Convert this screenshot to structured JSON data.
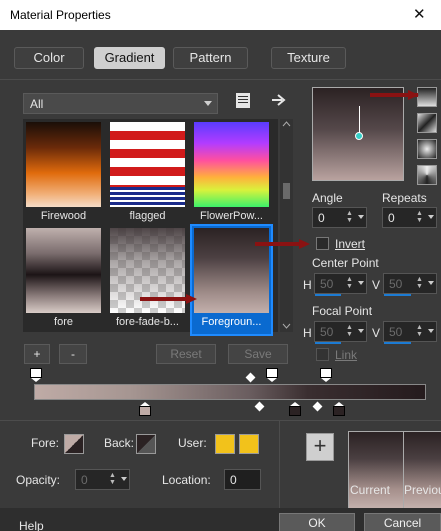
{
  "window": {
    "title": "Material Properties",
    "close": "✕"
  },
  "tabs": [
    {
      "label": "Color",
      "active": false
    },
    {
      "label": "Gradient",
      "active": true
    },
    {
      "label": "Pattern",
      "active": false
    },
    {
      "label": "Texture",
      "active": false
    }
  ],
  "category": {
    "value": "All"
  },
  "gallery": {
    "items": [
      {
        "label": "Firewood",
        "selected": false
      },
      {
        "label": "flagged",
        "selected": false
      },
      {
        "label": "FlowerPow...",
        "selected": false
      },
      {
        "label": "fore",
        "selected": false
      },
      {
        "label": "fore-fade-b...",
        "selected": false
      },
      {
        "label": "Foregroun...",
        "selected": true
      }
    ]
  },
  "controls": {
    "angle_label": "Angle",
    "angle_value": "0",
    "repeats_label": "Repeats",
    "repeats_value": "0",
    "invert_label": "Invert",
    "invert_checked": false,
    "center_label": "Center Point",
    "h_label": "H",
    "v_label": "V",
    "center_h": "50",
    "center_v": "50",
    "focal_label": "Focal Point",
    "focal_h": "50",
    "focal_v": "50",
    "link_label": "Link",
    "link_checked": false
  },
  "editor": {
    "add": "+",
    "remove": "-",
    "reset": "Reset",
    "save": "Save"
  },
  "footer": {
    "fore_label": "Fore:",
    "back_label": "Back:",
    "user_label": "User:",
    "user_color": "#f2c21b",
    "opacity_label": "Opacity:",
    "opacity_value": "0",
    "location_label": "Location:",
    "location_value": "0",
    "current_label": "Current",
    "previous_label": "Previous",
    "add_swatch": "+"
  },
  "buttons": {
    "help": "Help",
    "ok": "OK",
    "cancel": "Cancel"
  }
}
